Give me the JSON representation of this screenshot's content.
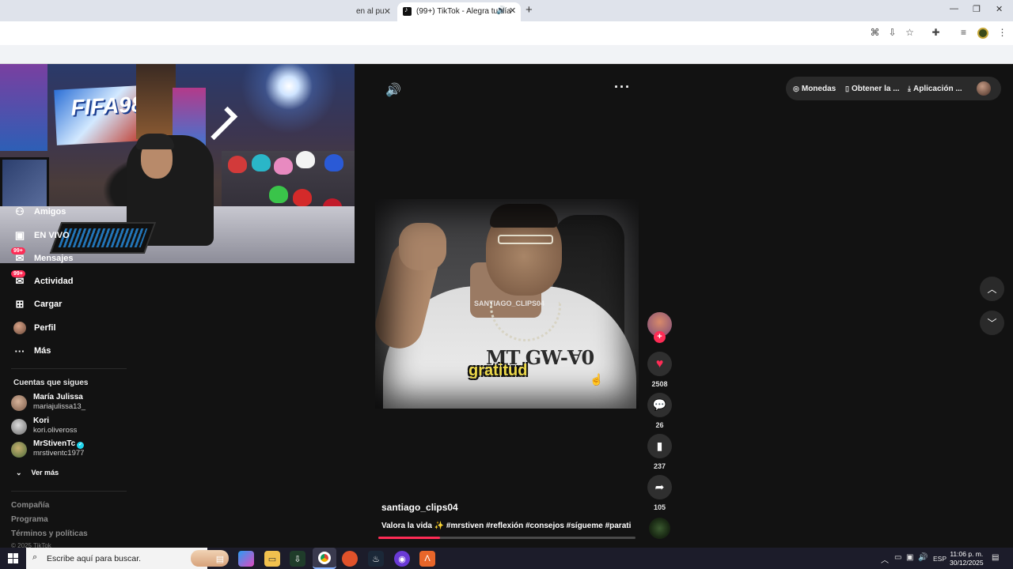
{
  "browser": {
    "tab_partial": "en al pu",
    "active_tab": "(99+) TikTok - Alegra tu día",
    "new_tab": "+",
    "win_minimize": "—",
    "win_restore": "❐",
    "win_close": "✕"
  },
  "header": {
    "pills": [
      {
        "icon": "coin-icon",
        "glyph": "◎",
        "label": "Monedas"
      },
      {
        "icon": "phone-icon",
        "glyph": "▯",
        "label": "Obtener la ..."
      },
      {
        "icon": "download-icon",
        "glyph": "⤓",
        "label": "Aplicación ..."
      }
    ]
  },
  "sidebar": {
    "items": [
      {
        "label": "Amigos",
        "icon": "friends-icon",
        "glyph": "⚇"
      },
      {
        "label": "EN VIVO",
        "icon": "live-icon",
        "glyph": "▣"
      },
      {
        "label": "Mensajes",
        "icon": "message-icon",
        "glyph": "✉",
        "badge": "99+"
      },
      {
        "label": "Actividad",
        "icon": "activity-icon",
        "glyph": "✉",
        "badge": "99+"
      },
      {
        "label": "Cargar",
        "icon": "upload-icon",
        "glyph": "⊞"
      },
      {
        "label": "Perfil",
        "icon": "avatar"
      },
      {
        "label": "Más",
        "icon": "more-icon",
        "glyph": "···"
      }
    ],
    "following_title": "Cuentas que sigues",
    "following": [
      {
        "name": "María Julissa",
        "username": "mariajulissa13_",
        "verified": false
      },
      {
        "name": "Kori",
        "username": "kori.oliveross",
        "verified": false
      },
      {
        "name": "MrStivenTc",
        "username": "mrstiventc1977",
        "verified": true
      }
    ],
    "see_more": "Ver más",
    "footer_links": [
      "Compañía",
      "Programa",
      "Términos y políticas"
    ],
    "copyright": "© 2025 TikTok"
  },
  "video": {
    "watermark": "SANTIAGO_CLIPS04",
    "shirt_print": "MT GW-Ɐ0",
    "caption": "gratitud",
    "author": "santiago_clips04",
    "description": "Valora la vida ✨ #mrstiven #reflexión #consejos #sígueme #parati",
    "progress_percent": 24
  },
  "actions": {
    "likes": "2508",
    "comments": "26",
    "saves": "237",
    "shares": "105"
  },
  "taskbar": {
    "search_placeholder": "Escribe aquí para buscar.",
    "language": "ESP",
    "time": "11:06 p. m.",
    "date": "30/12/2025"
  },
  "colors": {
    "accent": "#fe2c55",
    "background": "#121212",
    "verified": "#20d5ec"
  }
}
